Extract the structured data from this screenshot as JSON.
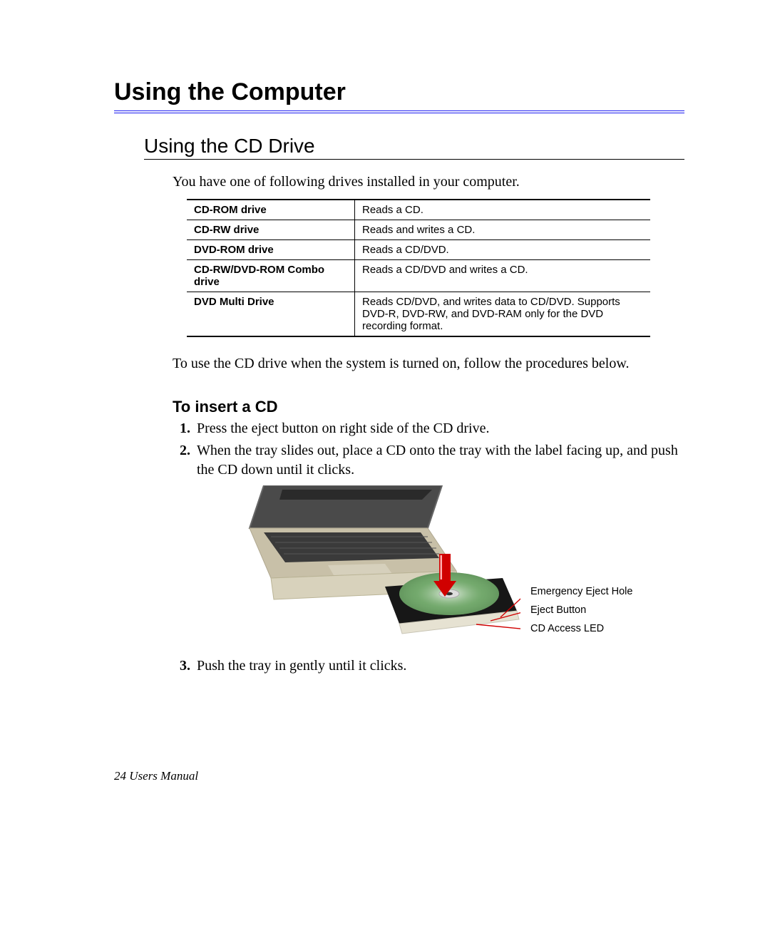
{
  "chapter_title": "Using the Computer",
  "section_title": "Using the CD Drive",
  "intro_text": "You have one of following drives installed in your computer.",
  "drive_table": [
    {
      "name": "CD-ROM drive",
      "desc": "Reads a CD."
    },
    {
      "name": "CD-RW drive",
      "desc": "Reads and writes a CD."
    },
    {
      "name": "DVD-ROM drive",
      "desc": "Reads a CD/DVD."
    },
    {
      "name": "CD-RW/DVD-ROM Combo drive",
      "desc": "Reads a CD/DVD and writes a CD."
    },
    {
      "name": "DVD Multi Drive",
      "desc": "Reads CD/DVD, and writes data to CD/DVD. Supports DVD-R, DVD-RW, and DVD-RAM only for the DVD recording format."
    }
  ],
  "usage_text": "To use the CD drive when the system is turned on, follow the procedures below.",
  "insert_heading": "To insert a CD",
  "steps": [
    "Press the eject button on right side of the CD drive.",
    "When the tray slides out, place a CD onto the tray with the label facing up, and push the CD down until it clicks.",
    "Push the tray in gently until it clicks."
  ],
  "callouts": {
    "emergency": "Emergency Eject Hole",
    "eject": "Eject Button",
    "led": "CD Access LED"
  },
  "footer": "24  Users Manual"
}
